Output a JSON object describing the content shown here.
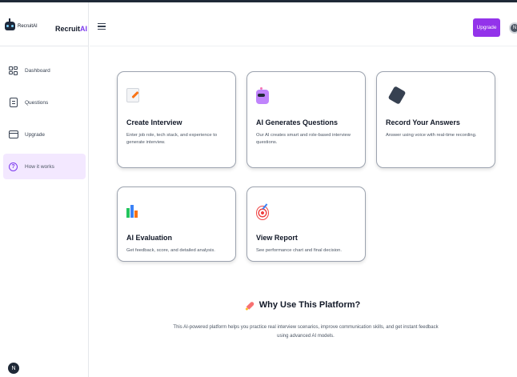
{
  "brand": {
    "small_name": "RecruitAI",
    "name_prefix": "Recruit",
    "name_suffix": "AI"
  },
  "sidebar": {
    "items": [
      {
        "label": "Dashboard",
        "icon": "dashboard-grid-icon",
        "active": false
      },
      {
        "label": "Questions",
        "icon": "document-icon",
        "active": false
      },
      {
        "label": "Upgrade",
        "icon": "credit-card-icon",
        "active": false
      },
      {
        "label": "How it works",
        "icon": "help-circle-icon",
        "active": true
      }
    ],
    "user_initial": "N"
  },
  "header": {
    "upgrade_label": "Upgrade",
    "avatar_initial": "N",
    "menu_icon": "hamburger-icon"
  },
  "cards": [
    {
      "title": "Create Interview",
      "description": "Enter job role, tech stack, and experience to generate interview.",
      "icon": "document-pencil-icon"
    },
    {
      "title": "AI Generates Questions",
      "description": "Our AI creates smart and role-based interview questions.",
      "icon": "robot-icon"
    },
    {
      "title": "Record Your Answers",
      "description": "Answer using voice with real-time recording.",
      "icon": "microphone-icon"
    },
    {
      "title": "AI Evaluation",
      "description": "Get feedback, score, and detailed analysis.",
      "icon": "bar-chart-icon"
    },
    {
      "title": "View Report",
      "description": "See performance chart and final decision.",
      "icon": "target-icon"
    }
  ],
  "why": {
    "title": "Why Use This Platform?",
    "description": "This AI-powered platform helps you practice real interview scenarios, improve communication skills, and get instant feedback using advanced AI models.",
    "icon": "rocket-icon"
  },
  "colors": {
    "accent": "#9333ea",
    "active_nav_bg": "#f3e8ff"
  }
}
